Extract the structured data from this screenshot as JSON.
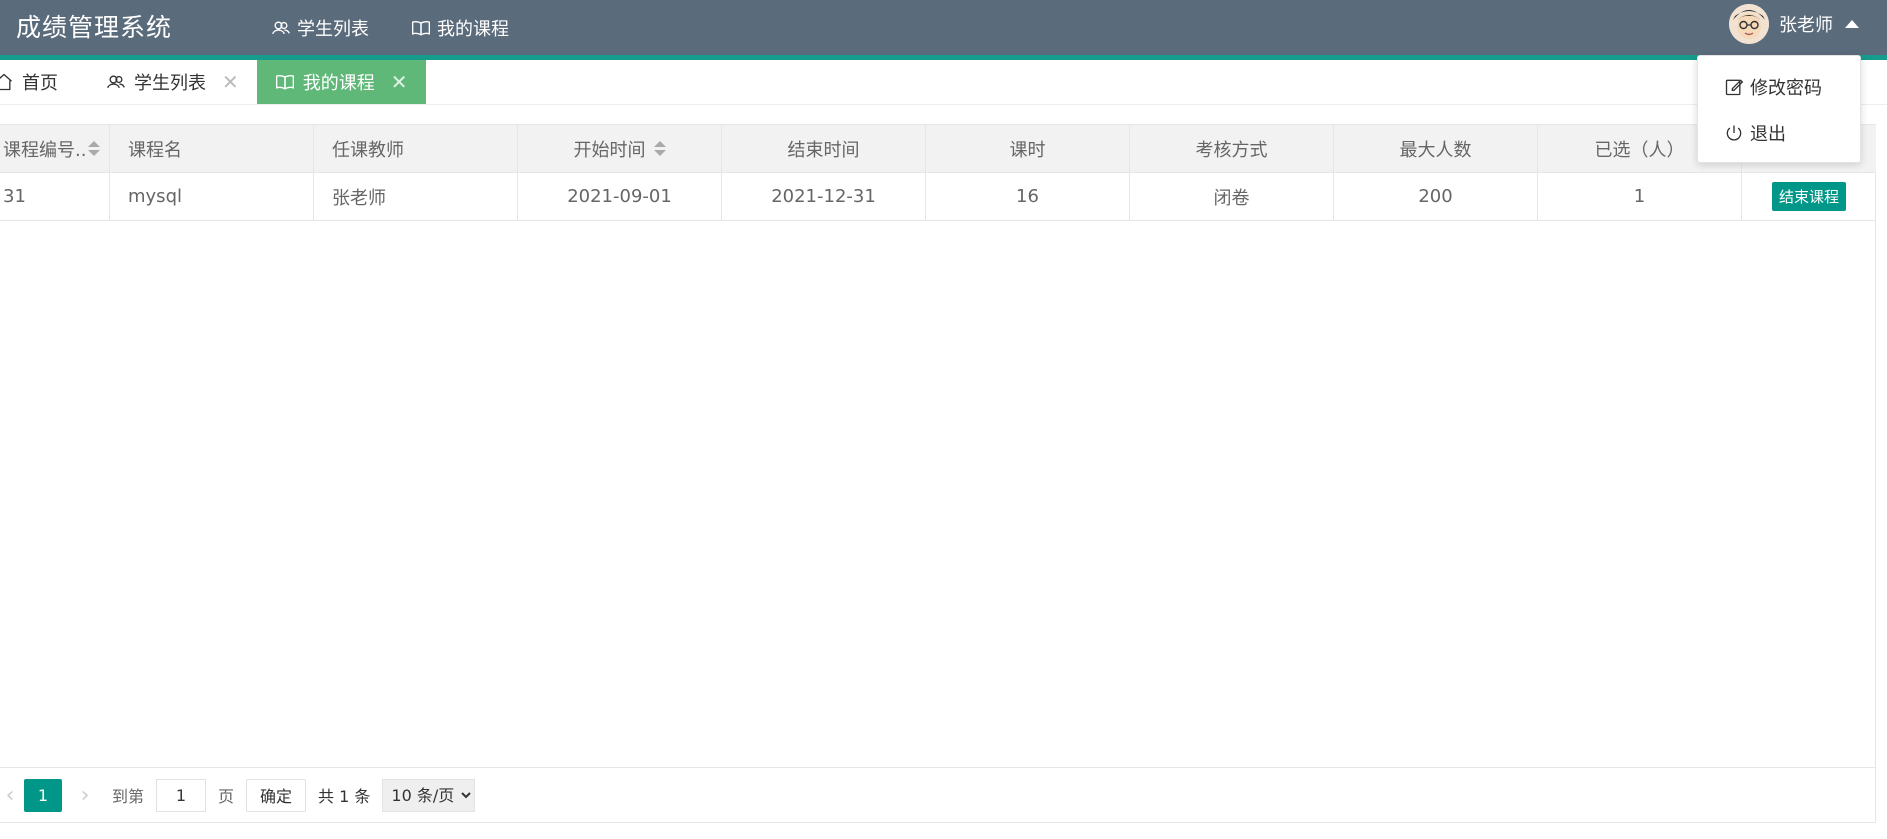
{
  "header": {
    "title": "成绩管理系统",
    "nav": [
      {
        "label": "学生列表",
        "icon": "users-icon"
      },
      {
        "label": "我的课程",
        "icon": "book-icon",
        "active": true
      }
    ],
    "user": {
      "name": "张老师"
    }
  },
  "user_menu": {
    "items": [
      {
        "label": "修改密码",
        "icon": "edit-icon"
      },
      {
        "label": "退出",
        "icon": "power-icon"
      }
    ]
  },
  "tabs": [
    {
      "label": "首页",
      "icon": "home-icon",
      "closable": false
    },
    {
      "label": "学生列表",
      "icon": "users-icon",
      "closable": true
    },
    {
      "label": "我的课程",
      "icon": "book-icon",
      "closable": true,
      "active": true
    }
  ],
  "table": {
    "columns": [
      "课程编号..",
      "课程名",
      "任课教师",
      "开始时间",
      "结束时间",
      "课时",
      "考核方式",
      "最大人数",
      "已选（人）"
    ],
    "rows": [
      {
        "id": "31",
        "name": "mysql",
        "teacher": "张老师",
        "start": "2021-09-01",
        "end": "2021-12-31",
        "hours": "16",
        "exam": "闭卷",
        "max": "200",
        "selected": "1",
        "action": "结束课程"
      }
    ]
  },
  "pager": {
    "current": "1",
    "goto_prefix": "到第",
    "goto_value": "1",
    "goto_suffix": "页",
    "confirm": "确定",
    "total": "共 1 条",
    "page_size": "10 条/页"
  },
  "colors": {
    "topbar": "#5a6b7b",
    "accent": "#169c8c",
    "active_tab": "#5fb878",
    "primary": "#009688"
  }
}
